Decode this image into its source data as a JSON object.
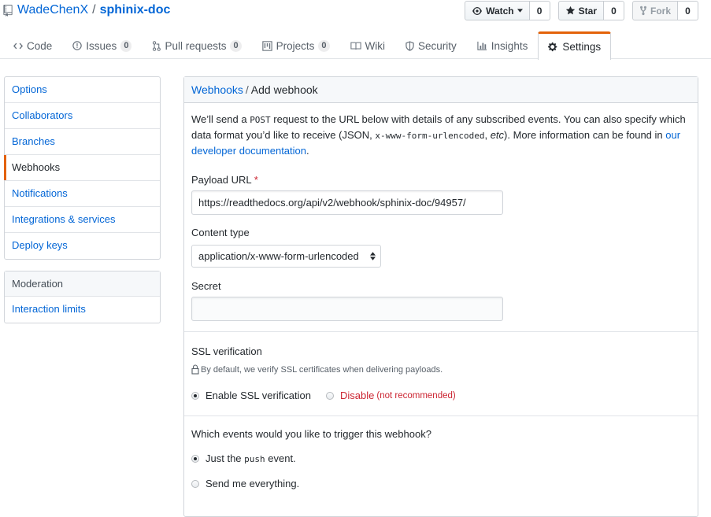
{
  "repo": {
    "owner": "WadeChenX",
    "name": "sphinix-doc",
    "separator": "/"
  },
  "actions": {
    "watch": {
      "label": "Watch",
      "count": "0"
    },
    "star": {
      "label": "Star",
      "count": "0"
    },
    "fork": {
      "label": "Fork",
      "count": "0"
    }
  },
  "tabs": [
    {
      "label": "Code",
      "icon": "code-icon"
    },
    {
      "label": "Issues",
      "icon": "issue-icon",
      "count": "0"
    },
    {
      "label": "Pull requests",
      "icon": "pull-request-icon",
      "count": "0"
    },
    {
      "label": "Projects",
      "icon": "project-icon",
      "count": "0"
    },
    {
      "label": "Wiki",
      "icon": "book-icon"
    },
    {
      "label": "Security",
      "icon": "shield-icon"
    },
    {
      "label": "Insights",
      "icon": "graph-icon"
    },
    {
      "label": "Settings",
      "icon": "gear-icon",
      "selected": true
    }
  ],
  "sidebar": {
    "items": [
      {
        "label": "Options"
      },
      {
        "label": "Collaborators"
      },
      {
        "label": "Branches"
      },
      {
        "label": "Webhooks",
        "selected": true
      },
      {
        "label": "Notifications"
      },
      {
        "label": "Integrations & services"
      },
      {
        "label": "Deploy keys"
      }
    ],
    "moderation": {
      "heading": "Moderation",
      "items": [
        {
          "label": "Interaction limits"
        }
      ]
    }
  },
  "form": {
    "breadcrumb": {
      "parent": "Webhooks",
      "separator": "/",
      "current": "Add webhook"
    },
    "intro": {
      "t1": "We’ll send a ",
      "code1": "POST",
      "t2": " request to the URL below with details of any subscribed events. You can also specify which data format you’d like to receive (JSON, ",
      "code2": "x-www-form-urlencoded",
      "t3": ", ",
      "em": "etc",
      "t4": "). More information can be found in ",
      "link": "our developer documentation",
      "t5": "."
    },
    "payload_url": {
      "label": "Payload URL",
      "required_mark": "*",
      "value": "https://readthedocs.org/api/v2/webhook/sphinix-doc/94957/"
    },
    "content_type": {
      "label": "Content type",
      "value": "application/x-www-form-urlencoded"
    },
    "secret": {
      "label": "Secret",
      "value": ""
    },
    "ssl": {
      "title": "SSL verification",
      "note": "By default, we verify SSL certificates when delivering payloads.",
      "enable_label": "Enable SSL verification",
      "disable_label": "Disable",
      "disable_note": "(not recommended)",
      "selected": "enable"
    },
    "events": {
      "question": "Which events would you like to trigger this webhook?",
      "option1_pre": "Just the ",
      "option1_code": "push",
      "option1_post": " event.",
      "option2": "Send me everything.",
      "selected": "push"
    }
  },
  "colors": {
    "link": "#0366d6",
    "accent_tab": "#e36209",
    "danger": "#cb2431",
    "text": "#24292e",
    "muted": "#586069",
    "border": "#d1d5da"
  }
}
